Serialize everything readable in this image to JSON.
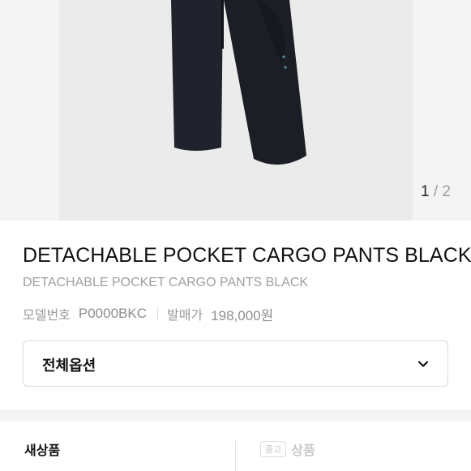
{
  "gallery": {
    "page_current": "1",
    "page_separator": " / ",
    "page_total": "2"
  },
  "product": {
    "title": "DETACHABLE POCKET CARGO PANTS BLACK",
    "subtitle": "DETACHABLE POCKET CARGO PANTS BLACK",
    "model_label": "모델번호",
    "model_number": "P0000BKC",
    "price_label": "발매가",
    "release_price": "198,000원"
  },
  "options": {
    "select_label": "전체옵션",
    "icon": "chevron-down-icon"
  },
  "condition_tabs": {
    "new_label": "새상품",
    "used_badge": "중고",
    "used_label": "상품"
  }
}
